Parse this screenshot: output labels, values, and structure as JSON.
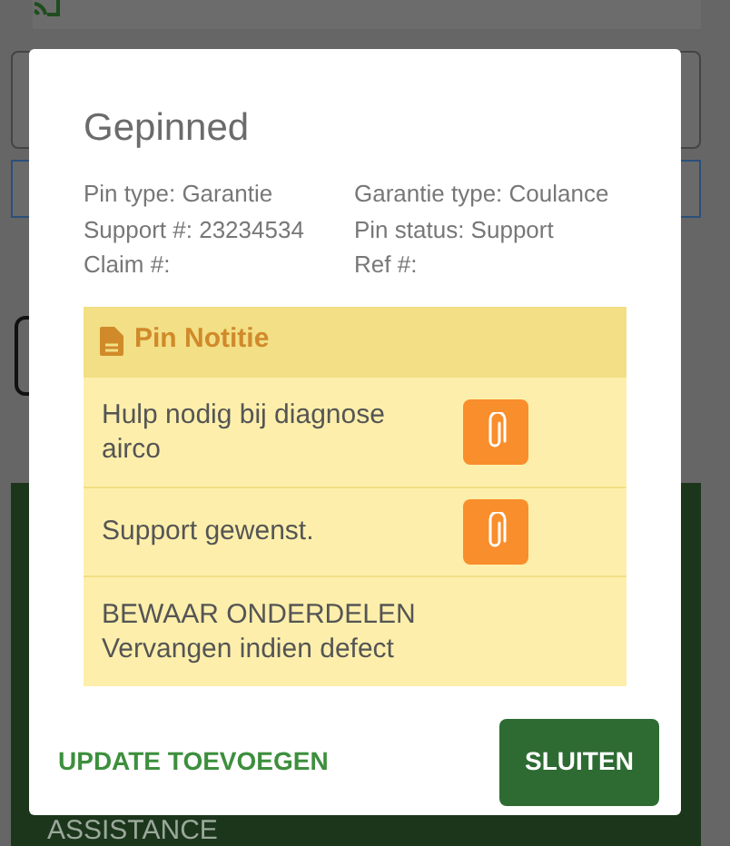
{
  "background": {
    "bottom_label": "ASSISTANCE"
  },
  "dialog": {
    "title": "Gepinned",
    "fields": [
      {
        "label": "Pin type:",
        "value": "Garantie"
      },
      {
        "label": "Garantie type:",
        "value": "Coulance"
      },
      {
        "label": "Support #:",
        "value": "23234534"
      },
      {
        "label": "Pin status:",
        "value": "Support"
      },
      {
        "label": "Claim #:"
      },
      {
        "label": "Ref #:"
      }
    ],
    "notes": {
      "title": "Pin Notitie",
      "items": [
        {
          "text": "Hulp nodig bij diagnose airco",
          "attachment": true
        },
        {
          "text": "Support gewenst.",
          "attachment": true
        },
        {
          "text": "BEWAAR ONDERDELEN\nVervangen indien defect",
          "attachment": false
        }
      ]
    },
    "buttons": [
      {
        "label": "UPDATE TOEVOEGEN",
        "kind": "text"
      },
      {
        "label": "SLUITEN",
        "kind": "filled"
      }
    ]
  }
}
